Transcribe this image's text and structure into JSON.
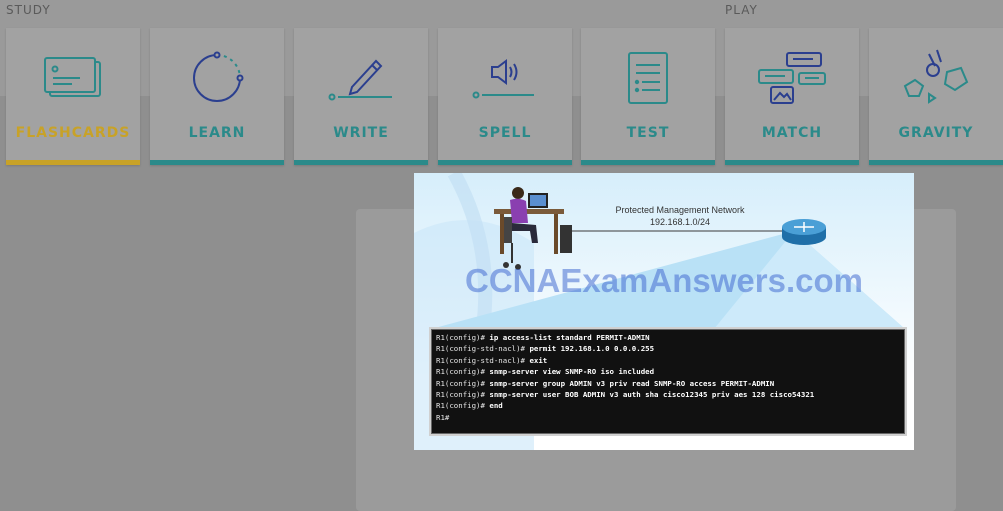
{
  "sections": {
    "study_label": "STUDY",
    "play_label": "PLAY"
  },
  "modes": [
    {
      "label": "FLASHCARDS",
      "icon": "flashcards-icon",
      "active": true
    },
    {
      "label": "LEARN",
      "icon": "learn-icon",
      "active": false
    },
    {
      "label": "WRITE",
      "icon": "write-icon",
      "active": false
    },
    {
      "label": "SPELL",
      "icon": "spell-icon",
      "active": false
    },
    {
      "label": "TEST",
      "icon": "test-icon",
      "active": false
    },
    {
      "label": "MATCH",
      "icon": "match-icon",
      "active": false
    },
    {
      "label": "GRAVITY",
      "icon": "gravity-icon",
      "active": false
    }
  ],
  "colors": {
    "accent_active": "#c8a227",
    "accent": "#2b8a8a",
    "background": "#8f8f8f"
  },
  "figure": {
    "network_title": "Protected Management Network",
    "network_subnet": "192.168.1.0/24",
    "watermark": "CCNAExamAnswers.com",
    "terminal_lines": [
      {
        "prompt": "R1(config)# ",
        "cmd": "ip access-list standard PERMIT-ADMIN"
      },
      {
        "prompt": "R1(config-std-nacl)# ",
        "cmd": "permit 192.168.1.0 0.0.0.255"
      },
      {
        "prompt": "R1(config-std-nacl)# ",
        "cmd": "exit"
      },
      {
        "prompt": "R1(config)# ",
        "cmd": "snmp-server view SNMP-RO iso included"
      },
      {
        "prompt": "R1(config)# ",
        "cmd": "snmp-server group ADMIN v3 priv read SNMP-RO access PERMIT-ADMIN"
      },
      {
        "prompt": "R1(config)# ",
        "cmd": "snmp-server user BOB ADMIN v3 auth sha cisco12345 priv aes 128 cisco54321"
      },
      {
        "prompt": "R1(config)# ",
        "cmd": "end"
      },
      {
        "prompt": "R1#",
        "cmd": ""
      }
    ]
  }
}
